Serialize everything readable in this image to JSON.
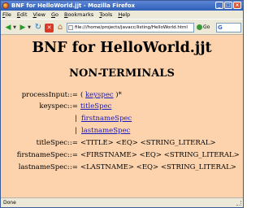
{
  "window": {
    "title": "BNF for HelloWorld.jjt - Mozilla Firefox"
  },
  "menubar": {
    "items": [
      "File",
      "Edit",
      "View",
      "Go",
      "Bookmarks",
      "Tools",
      "Help"
    ]
  },
  "toolbar": {
    "back_icon": "back-arrow-icon",
    "forward_icon": "forward-arrow-icon",
    "reload_icon": "reload-icon",
    "stop_icon": "stop-icon",
    "home_icon": "home-icon",
    "url": "file:///home/projects/javacc/listing/HelloWorld.html",
    "go_label": "Go",
    "search_engine_icon": "google-icon"
  },
  "page": {
    "heading": "BNF for HelloWorld.jjt",
    "subheading": "NON-TERMINALS",
    "productions": [
      {
        "name": "processInput",
        "sep": "::=",
        "pre": "( ",
        "link": "keyspec",
        "post": " )*"
      },
      {
        "name": "keyspec",
        "sep": "::=",
        "pre": "",
        "link": "titleSpec",
        "post": ""
      },
      {
        "name": "",
        "sep": "",
        "pre": "|",
        "link": "firstnameSpec",
        "post": ""
      },
      {
        "name": "",
        "sep": "",
        "pre": "|",
        "link": "lastnameSpec",
        "post": ""
      },
      {
        "name": "titleSpec",
        "sep": "::=",
        "text": "<TITLE> <EQ> <STRING_LITERAL>"
      },
      {
        "name": "firstnameSpec",
        "sep": "::=",
        "text": "<FIRSTNAME> <EQ> <STRING_LITERAL>"
      },
      {
        "name": "lastnameSpec",
        "sep": "::=",
        "text": "<LASTNAME> <EQ> <STRING_LITERAL>"
      }
    ],
    "background_color": "#fcd3ad",
    "link_color": "#1a1ab8"
  },
  "statusbar": {
    "text": "Done"
  }
}
